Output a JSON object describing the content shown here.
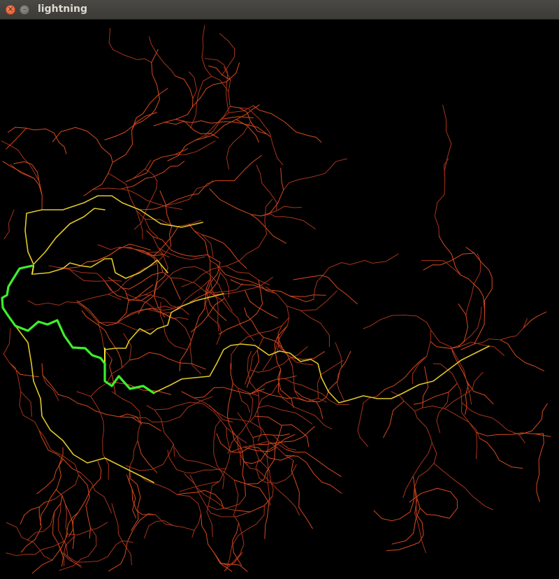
{
  "window": {
    "title": "lightning",
    "close_glyph": "×",
    "minimize_glyph": "–",
    "close_icon": "close-icon",
    "minimize_icon": "minimize-icon"
  },
  "colors": {
    "background": "#000000",
    "branch": "#d84a1e",
    "branch_dim": "#a8331a",
    "main_path": "#e0c828",
    "main_path_hot": "#f2e63a",
    "strike_path": "#3df02a"
  }
}
